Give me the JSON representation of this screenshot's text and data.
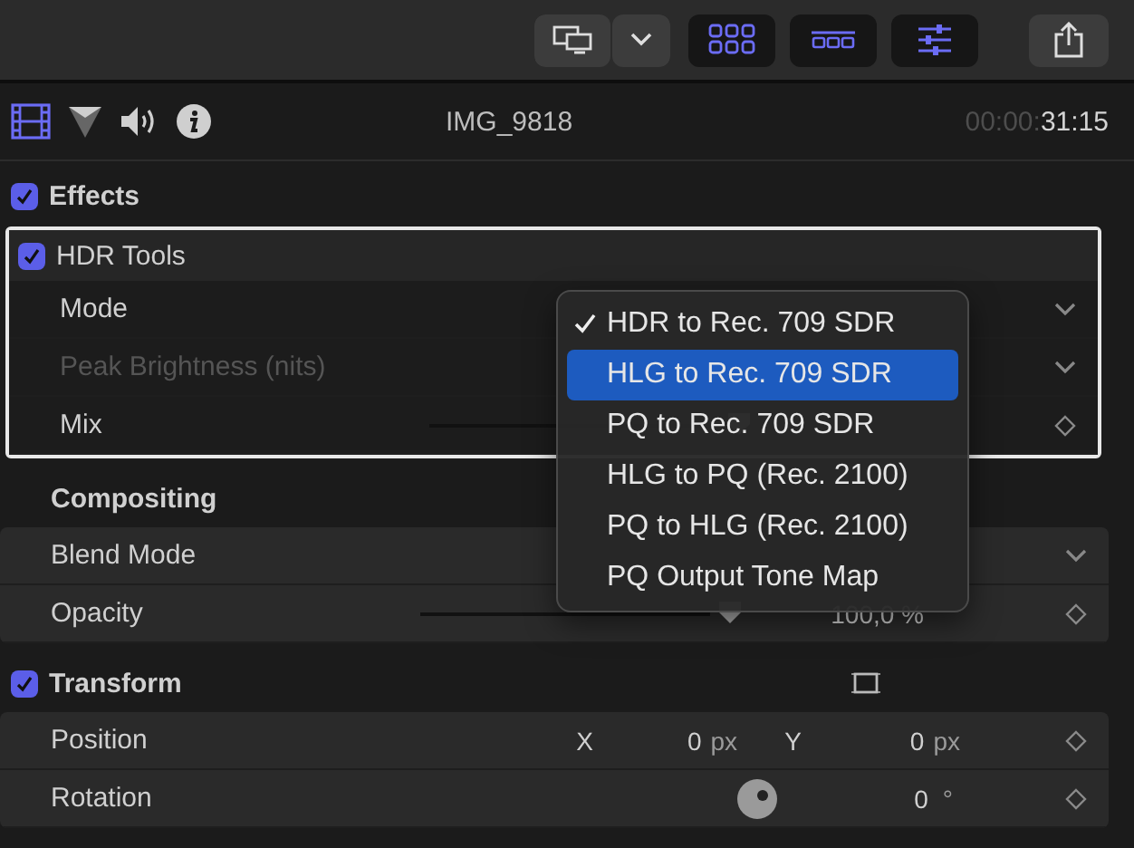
{
  "toolbar": {
    "buttons": [
      {
        "kind": "display",
        "selected": false
      },
      {
        "kind": "dropdown",
        "selected": false
      },
      {
        "kind": "browser",
        "selected": true
      },
      {
        "kind": "timeline",
        "selected": true
      },
      {
        "kind": "inspector",
        "selected": true
      },
      {
        "kind": "share",
        "selected": false
      }
    ]
  },
  "inspector_tabs": [
    {
      "kind": "video",
      "selected": true
    },
    {
      "kind": "color",
      "selected": false
    },
    {
      "kind": "audio",
      "selected": false
    },
    {
      "kind": "info",
      "selected": false
    }
  ],
  "clip_name": "IMG_9818",
  "timecode": {
    "dim": "00:00:",
    "main": "31:15"
  },
  "effects": {
    "label": "Effects",
    "checked": true
  },
  "hdr_tools": {
    "label": "HDR Tools",
    "checked": true,
    "selected": true,
    "params": [
      {
        "kind": "popup",
        "label": "Mode",
        "disabled": false
      },
      {
        "kind": "popup",
        "label": "Peak Brightness (nits)",
        "disabled": true
      },
      {
        "kind": "slider",
        "label": "Mix",
        "disabled": false
      }
    ]
  },
  "compositing": {
    "label": "Compositing",
    "params": [
      {
        "kind": "popup",
        "label": "Blend Mode"
      },
      {
        "kind": "slider",
        "label": "Opacity",
        "value": "100,0 %"
      }
    ]
  },
  "transform": {
    "label": "Transform",
    "checked": true,
    "params": [
      {
        "kind": "point",
        "label": "Position",
        "x_label": "X",
        "x_value": "0",
        "x_unit": "px",
        "y_label": "Y",
        "y_value": "0",
        "y_unit": "px"
      },
      {
        "kind": "angle",
        "label": "Rotation",
        "value": "0",
        "unit": "°"
      }
    ]
  },
  "menu": {
    "items": [
      {
        "label": "HDR to Rec. 709 SDR",
        "checked": true,
        "selected": false
      },
      {
        "label": "HLG to Rec. 709 SDR",
        "checked": false,
        "selected": true
      },
      {
        "label": "PQ to Rec. 709 SDR",
        "checked": false,
        "selected": false
      },
      {
        "label": "HLG to PQ (Rec. 2100)",
        "checked": false,
        "selected": false
      },
      {
        "label": "PQ to HLG (Rec. 2100)",
        "checked": false,
        "selected": false
      },
      {
        "label": "PQ Output Tone Map",
        "checked": false,
        "selected": false
      }
    ]
  }
}
